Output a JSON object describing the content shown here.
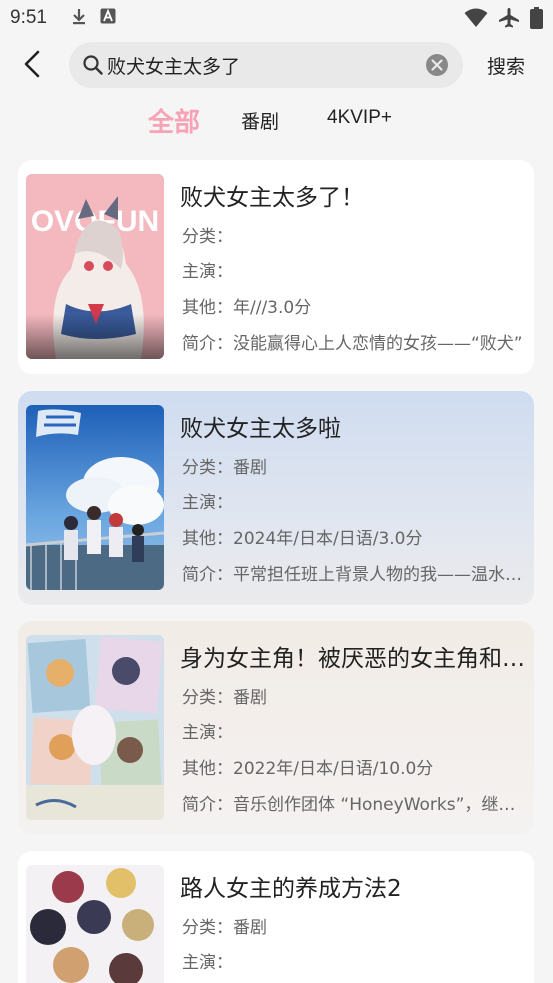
{
  "status": {
    "time": "9:51",
    "left_icons": [
      "download-icon",
      "a-icon"
    ],
    "right_icons": [
      "wifi-icon",
      "airplane-icon",
      "battery-icon"
    ]
  },
  "search": {
    "query": "败犬女主太多了",
    "button_label": "搜索"
  },
  "tabs": [
    {
      "label": "全部",
      "active": true
    },
    {
      "label": "番剧",
      "active": false
    },
    {
      "label": "4KVIP+",
      "active": false
    }
  ],
  "labels": {
    "category": "分类：",
    "cast": "主演：",
    "other": "其他：",
    "intro": "简介："
  },
  "results": [
    {
      "title": "败犬女主太多了！",
      "category": "",
      "cast": "",
      "other": "年///3.0分",
      "intro": "没能赢得心上人恋情的女孩——“败犬”",
      "poster_text": "OVOFUN"
    },
    {
      "title": "败犬女主太多啦",
      "category": "番剧",
      "cast": "",
      "other": "2024年/日本/日语/3.0分",
      "intro": "平常担任班上背景人物的我——温水和彦"
    },
    {
      "title": "身为女主角！被厌恶的女主角和秘密的工作",
      "category": "番剧",
      "cast": "",
      "other": "2022年/日本/日语/10.0分",
      "intro": "音乐创作团体 “HoneyWorks”，继续创作"
    },
    {
      "title": "路人女主的养成方法2",
      "category": "番剧",
      "cast": "",
      "other": "",
      "intro": ""
    }
  ],
  "colors": {
    "accent_pink": "#f6a3b5",
    "background": "#f5f5f5",
    "search_bg": "#e9e9e9"
  }
}
